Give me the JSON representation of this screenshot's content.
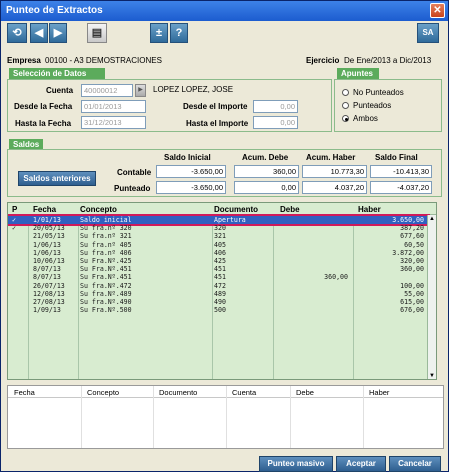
{
  "window": {
    "title": "Punteo de Extractos",
    "close": "✕"
  },
  "toolbar": {
    "refresh": "⟲",
    "prev": "◀",
    "next": "▶",
    "print": "▤",
    "plusminus": "±",
    "help": "?",
    "sa": "SA"
  },
  "header": {
    "empresa_label": "Empresa",
    "empresa_value": "00100 - A3 DEMOSTRACIONES",
    "ejercicio_label": "Ejercicio",
    "ejercicio_value": "De Ene/2013 a Dic/2013"
  },
  "seleccion": {
    "title": "Selección de Datos",
    "cuenta_label": "Cuenta",
    "cuenta_value": "40000012",
    "cuenta_name": "LOPEZ LOPEZ, JOSE",
    "desde_fecha_label": "Desde la Fecha",
    "desde_fecha_value": "01/01/2013",
    "hasta_fecha_label": "Hasta la Fecha",
    "hasta_fecha_value": "31/12/2013",
    "desde_importe_label": "Desde el Importe",
    "desde_importe_value": "0,00",
    "hasta_importe_label": "Hasta el Importe",
    "hasta_importe_value": "0,00"
  },
  "apuntes": {
    "title": "Apuntes",
    "options": [
      "No Punteados",
      "Punteados",
      "Ambos"
    ],
    "selected": "Ambos"
  },
  "saldos": {
    "title": "Saldos",
    "button": "Saldos anteriores",
    "col_headers": [
      "Saldo Inicial",
      "Acum. Debe",
      "Acum. Haber",
      "Saldo Final"
    ],
    "contable_label": "Contable",
    "contable": [
      "-3.650,00",
      "360,00",
      "10.773,30",
      "-10.413,30"
    ],
    "punteado_label": "Punteado",
    "punteado": [
      "-3.650,00",
      "0,00",
      "4.037,20",
      "-4.037,20"
    ]
  },
  "grid": {
    "headers": [
      "P",
      "Fecha",
      "Concepto",
      "Documento",
      "Debe",
      "Haber"
    ],
    "rows": [
      {
        "p": "✓",
        "fecha": "1/01/13",
        "concepto": "Saldo inicial",
        "documento": "Apertura",
        "debe": "",
        "haber": "3.650,00"
      },
      {
        "p": "✓",
        "fecha": "20/05/13",
        "concepto": "Su fra.nº 320",
        "documento": "320",
        "debe": "",
        "haber": "387,20"
      },
      {
        "p": "",
        "fecha": "21/05/13",
        "concepto": "Su fra.nº 321",
        "documento": "321",
        "debe": "",
        "haber": "677,60"
      },
      {
        "p": "",
        "fecha": "1/06/13",
        "concepto": "Su fra.nº 405",
        "documento": "405",
        "debe": "",
        "haber": "60,50"
      },
      {
        "p": "",
        "fecha": "1/06/13",
        "concepto": "Su fra.nº 406",
        "documento": "406",
        "debe": "",
        "haber": "3.872,00"
      },
      {
        "p": "",
        "fecha": "10/06/13",
        "concepto": "Su Fra.Nº.425",
        "documento": "425",
        "debe": "",
        "haber": "320,00"
      },
      {
        "p": "",
        "fecha": "8/07/13",
        "concepto": "Su Fra.Nº.451",
        "documento": "451",
        "debe": "",
        "haber": "360,00"
      },
      {
        "p": "",
        "fecha": "8/07/13",
        "concepto": "Su Fra.Nº.451",
        "documento": "451",
        "debe": "360,00",
        "haber": ""
      },
      {
        "p": "",
        "fecha": "26/07/13",
        "concepto": "Su fra.Nº.472",
        "documento": "472",
        "debe": "",
        "haber": "100,00"
      },
      {
        "p": "",
        "fecha": "12/08/13",
        "concepto": "Su fra.Nº.489",
        "documento": "489",
        "debe": "",
        "haber": "55,00"
      },
      {
        "p": "",
        "fecha": "27/08/13",
        "concepto": "Su fra.Nº.490",
        "documento": "490",
        "debe": "",
        "haber": "615,00"
      },
      {
        "p": "",
        "fecha": "1/09/13",
        "concepto": "Su Fra.Nº.500",
        "documento": "500",
        "debe": "",
        "haber": "676,00"
      }
    ]
  },
  "grid2": {
    "headers": [
      "Fecha",
      "Concepto",
      "Documento",
      "Cuenta",
      "Debe",
      "Haber"
    ]
  },
  "footer": {
    "punteo_masivo": "Punteo masivo",
    "aceptar": "Aceptar",
    "cancelar": "Cancelar"
  }
}
